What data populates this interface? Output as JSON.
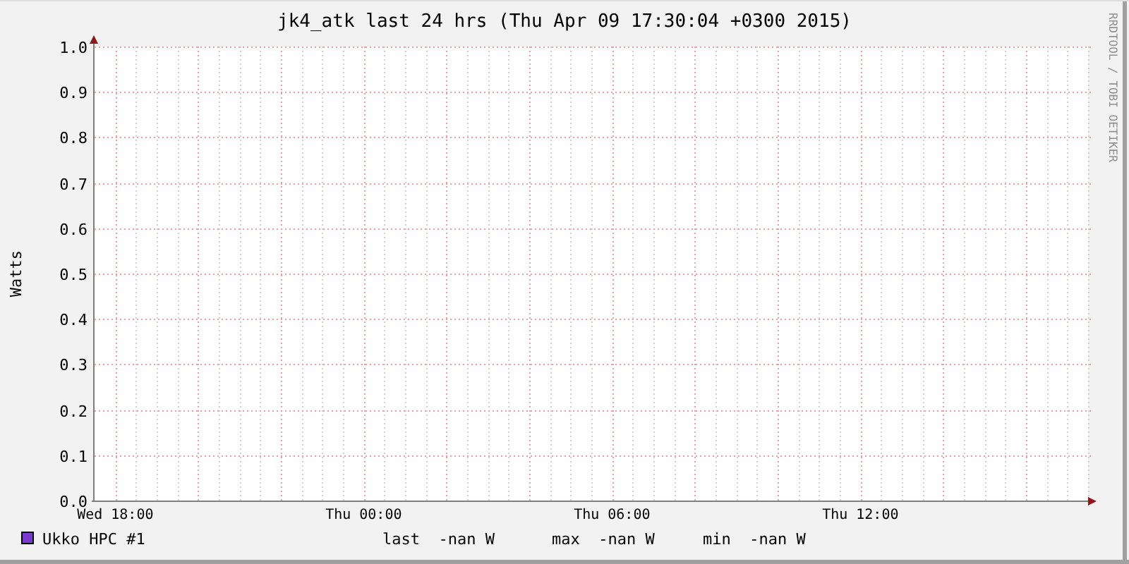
{
  "title": "jk4_atk last 24 hrs (Thu Apr 09 17:30:04 +0300 2015)",
  "credit": "RRDTOOL / TOBI OETIKER",
  "chart_data": {
    "type": "line",
    "grid": true,
    "ylabel": "Watts",
    "categories": [
      null,
      "Wed 18:00",
      null,
      null,
      null,
      null,
      null,
      null,
      null,
      null,
      null,
      null,
      null,
      "Thu 00:00",
      null,
      null,
      null,
      null,
      null,
      null,
      null,
      null,
      null,
      null,
      null,
      "Thu 06:00",
      null,
      null,
      null,
      null,
      null,
      null,
      null,
      null,
      null,
      null,
      null,
      "Thu 12:00",
      null,
      null,
      null,
      null,
      null,
      null,
      null,
      null,
      null,
      null
    ],
    "ylim": [
      0,
      1
    ],
    "yticks": [
      {
        "value": 0,
        "label": "0.0"
      },
      {
        "value": 0.1,
        "label": "0.1"
      },
      {
        "value": 0.2,
        "label": "0.2"
      },
      {
        "value": 0.3,
        "label": "0.3"
      },
      {
        "value": 0.4,
        "label": "0.4"
      },
      {
        "value": 0.5,
        "label": "0.5"
      },
      {
        "value": 0.6,
        "label": "0.6"
      },
      {
        "value": 0.7,
        "label": "0.7"
      },
      {
        "value": 0.8,
        "label": "0.8"
      },
      {
        "value": 0.9,
        "label": "0.9"
      },
      {
        "value": 1,
        "label": "1.0"
      }
    ],
    "series": [
      {
        "name": "Ukko HPC #1",
        "color": "#7a3ad0",
        "values": [
          null,
          null,
          null,
          null,
          null,
          null,
          null,
          null,
          null,
          null,
          null,
          null,
          null,
          null,
          null,
          null,
          null,
          null,
          null,
          null,
          null,
          null,
          null,
          null,
          null,
          null,
          null,
          null,
          null,
          null,
          null,
          null,
          null,
          null,
          null,
          null,
          null,
          null,
          null,
          null,
          null,
          null,
          null,
          null,
          null,
          null,
          null,
          null
        ]
      }
    ]
  },
  "legend": {
    "stats": [
      {
        "label": "last",
        "value": "-nan W"
      },
      {
        "label": "max",
        "value": "-nan W"
      },
      {
        "label": "min",
        "value": "-nan W"
      }
    ]
  }
}
